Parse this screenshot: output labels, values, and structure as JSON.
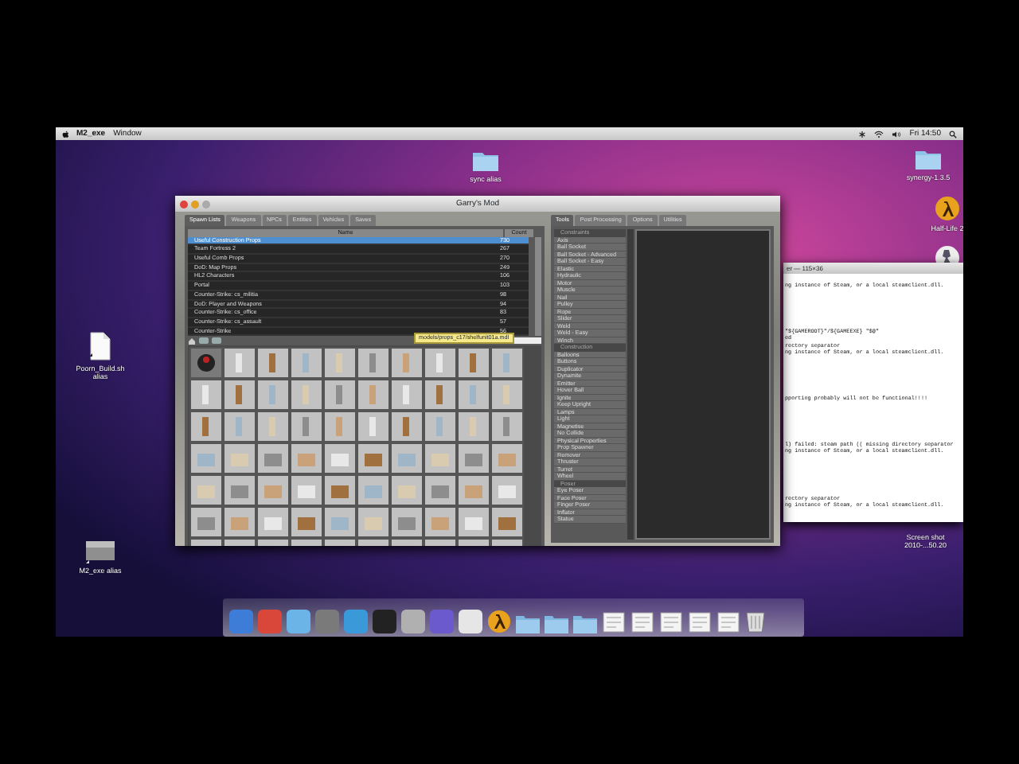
{
  "menu_bar": {
    "items": [
      "M2_exe",
      "Window"
    ],
    "clock": "Fri 14:50"
  },
  "desktop_icons": [
    {
      "kind": "folder",
      "label": "sync alias"
    },
    {
      "kind": "folder",
      "label": "synergy-1.3.5"
    },
    {
      "kind": "game",
      "label": "Half-Life 2"
    },
    {
      "kind": "document",
      "label": "Poorn_Build.sh alias"
    },
    {
      "kind": "disk",
      "label": "M2_exe alias"
    }
  ],
  "screenshot_label": [
    "Screen shot",
    "2010-...50.20"
  ],
  "game_window": {
    "title": "Garry's Mod",
    "left_tabs": [
      {
        "label": "Spawn Lists",
        "selected": true
      },
      {
        "label": "Weapons",
        "selected": false
      },
      {
        "label": "NPCs",
        "selected": false
      },
      {
        "label": "Entities",
        "selected": false
      },
      {
        "label": "Vehicles",
        "selected": false
      },
      {
        "label": "Saves",
        "selected": false
      }
    ],
    "spawn_list": {
      "columns": [
        "Name",
        "Count"
      ],
      "rows": [
        {
          "name": "Useful Construction Props",
          "count": "730",
          "selected": true
        },
        {
          "name": "Team Fortress 2",
          "count": "267",
          "selected": false
        },
        {
          "name": "Useful Comb Props",
          "count": "270",
          "selected": false
        },
        {
          "name": "DoD: Map Props",
          "count": "249",
          "selected": false
        },
        {
          "name": "HL2 Characters",
          "count": "106",
          "selected": false
        },
        {
          "name": "Portal",
          "count": "103",
          "selected": false
        },
        {
          "name": "Counter-Strike: cs_militia",
          "count": "98",
          "selected": false
        },
        {
          "name": "DoD: Player and Weapons",
          "count": "94",
          "selected": false
        },
        {
          "name": "Counter-Strike: cs_office",
          "count": "83",
          "selected": false
        },
        {
          "name": "Counter-Strike: cs_assault",
          "count": "57",
          "selected": false
        },
        {
          "name": "Counter-Strike",
          "count": "56",
          "selected": false
        }
      ]
    },
    "tooltip": "models/props_c17/shelfunit01a.mdl",
    "right_tabs": [
      {
        "label": "Tools",
        "selected": true
      },
      {
        "label": "Post Processing",
        "selected": false
      },
      {
        "label": "Options",
        "selected": false
      },
      {
        "label": "Utilities",
        "selected": false
      }
    ],
    "tool_groups": [
      {
        "title": "Constraints",
        "items": [
          "Axis",
          "Ball Socket",
          "Ball Socket - Advanced",
          "Ball Socket - Easy",
          "Elastic",
          "Hydraulic",
          "Motor",
          "Muscle",
          "Nail",
          "Pulley",
          "Rope",
          "Slider",
          "Weld",
          "Weld - Easy",
          "Winch"
        ]
      },
      {
        "title": "Construction",
        "items": [
          "Balloons",
          "Buttons",
          "Duplicator",
          "Dynamite",
          "Emitter",
          "Hover Ball",
          "Ignite",
          "Keep Upright",
          "Lamps",
          "Light",
          "Magnetise",
          "No Collide",
          "Physical Properties",
          "Prop Spawner",
          "Remover",
          "Thruster",
          "Turret",
          "Wheel"
        ]
      },
      {
        "title": "Poser",
        "items": [
          "Eye Poser",
          "Face Poser",
          "Finger Poser",
          "Inflator",
          "Statue"
        ]
      }
    ]
  },
  "terminal": {
    "title": "er — 115×36",
    "blocks": [
      [
        "ng instance of Steam, or a local steamclient.dll."
      ],
      [
        "\"${GAMEROOT}\"/${GAMEEXE} \"$@\"",
        "ed",
        "rectory separator",
        "ng instance of Steam, or a local steamclient.dll."
      ],
      [
        "pporting probably will not be functional!!!!"
      ],
      [
        "l) failed: steam path (( missing directory separator",
        "ng instance of Steam, or a local steamclient.dll."
      ],
      [
        "rectory separator",
        "ng instance of Steam, or a local steamclient.dll."
      ]
    ]
  },
  "dock": [
    {
      "kind": "app"
    },
    {
      "kind": "app"
    },
    {
      "kind": "app"
    },
    {
      "kind": "app"
    },
    {
      "kind": "app"
    },
    {
      "kind": "app"
    },
    {
      "kind": "app"
    },
    {
      "kind": "app"
    },
    {
      "kind": "app"
    },
    {
      "kind": "game"
    },
    {
      "kind": "folder"
    },
    {
      "kind": "folder"
    },
    {
      "kind": "folder"
    },
    {
      "kind": "document"
    },
    {
      "kind": "document"
    },
    {
      "kind": "document"
    },
    {
      "kind": "document"
    },
    {
      "kind": "document"
    },
    {
      "kind": "trash"
    }
  ]
}
